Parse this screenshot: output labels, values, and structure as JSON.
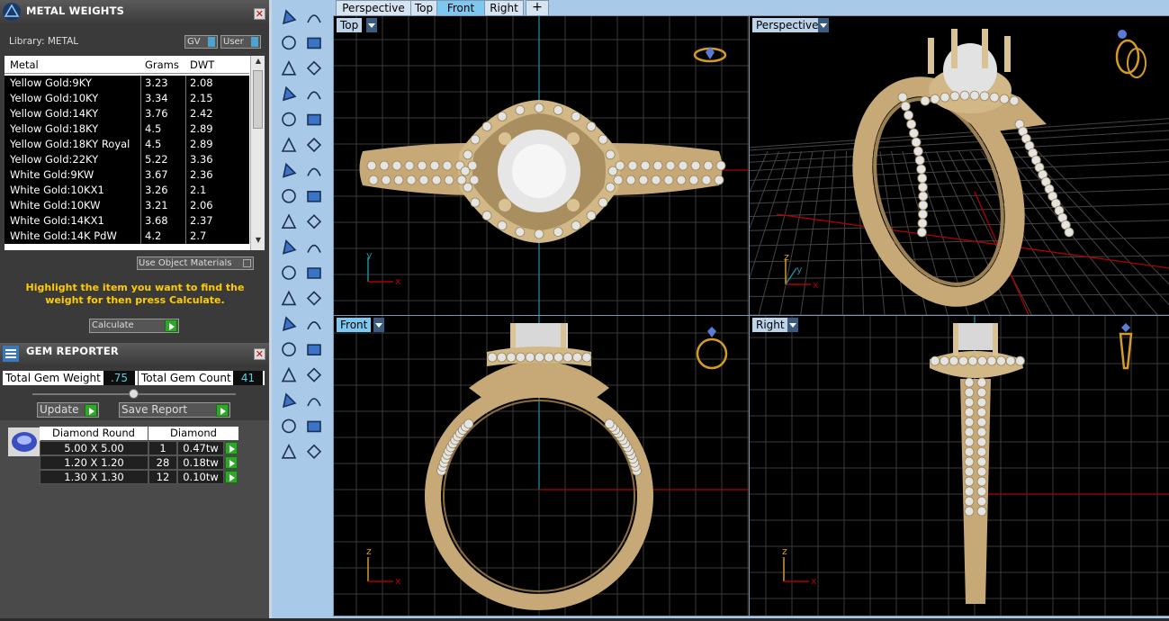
{
  "metal_weights": {
    "title": "METAL WEIGHTS",
    "library_label": "Library: METAL",
    "gv_label": "GV",
    "user_label": "User",
    "columns": [
      "Metal",
      "Grams",
      "DWT"
    ],
    "rows": [
      {
        "metal": "Yellow Gold:9KY",
        "grams": "3.23",
        "dwt": "2.08"
      },
      {
        "metal": "Yellow Gold:10KY",
        "grams": "3.34",
        "dwt": "2.15"
      },
      {
        "metal": "Yellow Gold:14KY",
        "grams": "3.76",
        "dwt": "2.42"
      },
      {
        "metal": "Yellow Gold:18KY",
        "grams": "4.5",
        "dwt": "2.89"
      },
      {
        "metal": "Yellow Gold:18KY Royal",
        "grams": "4.5",
        "dwt": "2.89"
      },
      {
        "metal": "Yellow Gold:22KY",
        "grams": "5.22",
        "dwt": "3.36"
      },
      {
        "metal": "White Gold:9KW",
        "grams": "3.67",
        "dwt": "2.36"
      },
      {
        "metal": "White Gold:10KX1",
        "grams": "3.26",
        "dwt": "2.1"
      },
      {
        "metal": "White Gold:10KW",
        "grams": "3.21",
        "dwt": "2.06"
      },
      {
        "metal": "White Gold:14KX1",
        "grams": "3.68",
        "dwt": "2.37"
      },
      {
        "metal": "White Gold:14K PdW",
        "grams": "4.2",
        "dwt": "2.7"
      }
    ],
    "use_object_materials": "Use Object Materials",
    "instruction": "Highlight the item you want to find the weight for then press Calculate.",
    "calculate_label": "Calculate"
  },
  "gem_reporter": {
    "title": "GEM REPORTER",
    "total_weight_label": "Total Gem Weight",
    "total_weight_value": ".75",
    "total_count_label": "Total Gem Count",
    "total_count_value": "41",
    "update_label": "Update",
    "save_report_label": "Save Report",
    "columns": [
      "Diamond Round",
      "Diamond"
    ],
    "rows": [
      {
        "size": "5.00 X 5.00",
        "count": "1",
        "weight": "0.47tw"
      },
      {
        "size": "1.20 X 1.20",
        "count": "28",
        "weight": "0.18tw"
      },
      {
        "size": "1.30 X 1.30",
        "count": "12",
        "weight": "0.10tw"
      }
    ]
  },
  "tabs": [
    "Perspective",
    "Top",
    "Front",
    "Right"
  ],
  "active_tab": "Front",
  "viewports": {
    "top": {
      "label": "Top"
    },
    "perspective": {
      "label": "Perspective"
    },
    "front": {
      "label": "Front"
    },
    "right": {
      "label": "Right"
    }
  },
  "axes": {
    "x": "x",
    "y": "y",
    "z": "z"
  },
  "colors": {
    "viewport_bg": "#000000",
    "grid": "#3a3a3a",
    "x_axis": "#b00000",
    "y_axis": "#1f8a9a",
    "gold": "#c9ae7a",
    "accent": "#7cc8f0",
    "toolbar": "#a9c9e8",
    "instruction": "#ffcc00"
  }
}
